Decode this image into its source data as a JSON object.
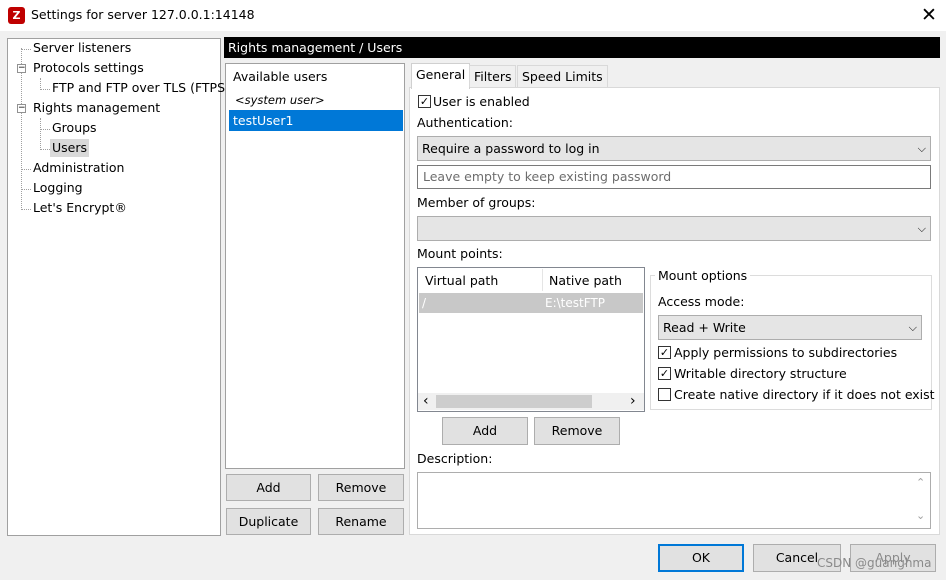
{
  "window": {
    "title": "Settings for server 127.0.0.1:14148",
    "icon": "filezilla-icon",
    "close_glyph": "✕"
  },
  "tree": {
    "items": [
      {
        "label": "Server listeners"
      },
      {
        "label": "Protocols settings"
      },
      {
        "label": "FTP and FTP over TLS (FTPS)"
      },
      {
        "label": "Rights management"
      },
      {
        "label": "Groups"
      },
      {
        "label": "Users"
      },
      {
        "label": "Administration"
      },
      {
        "label": "Logging"
      },
      {
        "label": "Let's Encrypt®"
      }
    ],
    "expander_glyph": "−"
  },
  "header": {
    "title": "Rights management / Users"
  },
  "users": {
    "heading": "Available users",
    "items": [
      "<system user>",
      "testUser1"
    ],
    "selected": "testUser1",
    "add_label": "Add",
    "remove_label": "Remove",
    "duplicate_label": "Duplicate",
    "rename_label": "Rename"
  },
  "tabs": [
    {
      "label": "General"
    },
    {
      "label": "Filters"
    },
    {
      "label": "Speed Limits"
    }
  ],
  "general": {
    "user_enabled_label": "User is enabled",
    "user_enabled": true,
    "auth_label": "Authentication:",
    "auth_value": "Require a password to log in",
    "password_placeholder": "Leave empty to keep existing password",
    "groups_label": "Member of groups:",
    "groups_value": "",
    "mount_label": "Mount points:",
    "mount_columns": [
      "Virtual path",
      "Native path"
    ],
    "mount_rows": [
      {
        "virtual": "/",
        "native": "E:\\testFTP"
      }
    ],
    "add_label": "Add",
    "remove_label": "Remove",
    "mount_options_label": "Mount options",
    "access_mode_label": "Access mode:",
    "access_mode_value": "Read + Write",
    "apply_perm_label": "Apply permissions to subdirectories",
    "apply_perm": true,
    "writable_label": "Writable directory structure",
    "writable": true,
    "create_native_label": "Create native directory if it does not exist",
    "create_native": false,
    "description_label": "Description:",
    "description_value": ""
  },
  "footer": {
    "ok_label": "OK",
    "cancel_label": "Cancel",
    "apply_label": "Apply"
  },
  "watermark": "CSDN @guanghma",
  "glyphs": {
    "check": "✓",
    "dropdown": "⌵",
    "left": "‹",
    "right": "›",
    "up": "⌃",
    "down": "⌄"
  }
}
